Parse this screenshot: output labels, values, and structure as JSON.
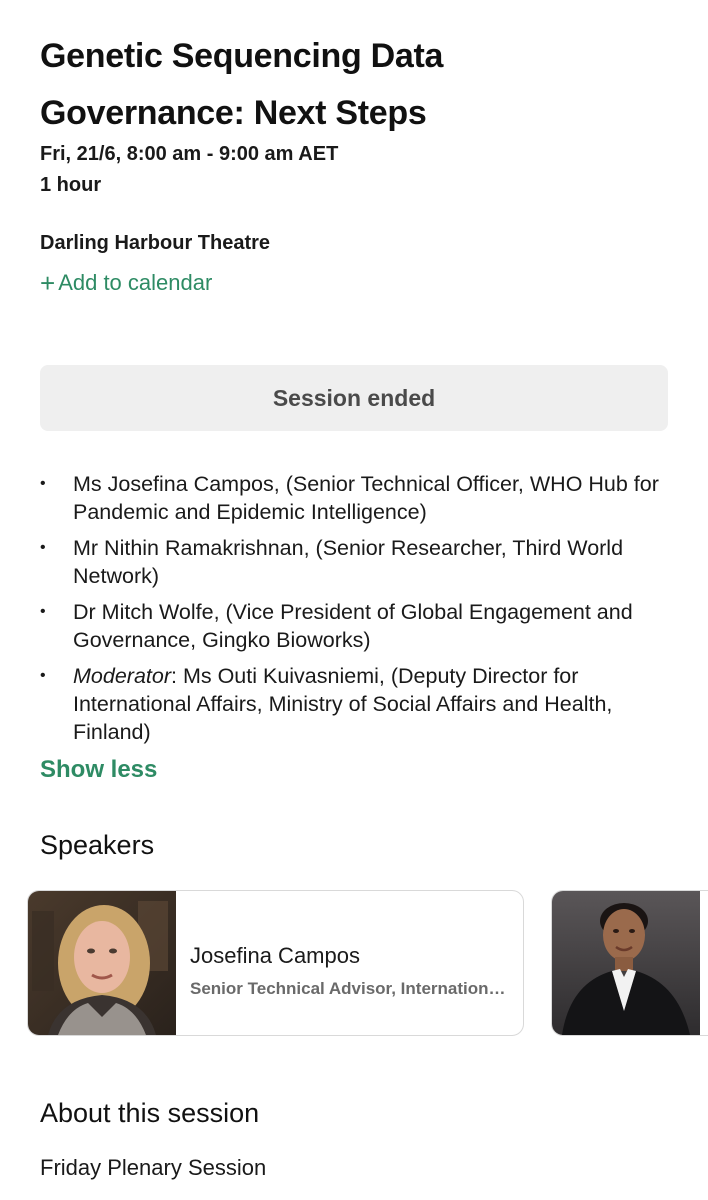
{
  "event": {
    "title_line1": "Genetic Sequencing Data",
    "title_line2": "Governance: Next Steps",
    "datetime": "Fri, 21/6, 8:00 am - 9:00 am AET",
    "duration": "1 hour",
    "location": "Darling Harbour Theatre",
    "add_to_calendar_icon": "plus-icon",
    "add_to_calendar_label": "Add to calendar",
    "status_label": "Session ended"
  },
  "description": {
    "items": [
      {
        "prefix": "",
        "text": "Ms Josefina Campos, (Senior Technical Officer, WHO Hub for Pandemic and Epidemic Intelligence)"
      },
      {
        "prefix": "",
        "text": "Mr Nithin Ramakrishnan, (Senior Researcher, Third World Network)"
      },
      {
        "prefix": "",
        "text": "Dr Mitch Wolfe, (Vice President of Global Engagement and Governance, Gingko Bioworks)"
      },
      {
        "prefix": "Moderator",
        "text": ": Ms Outi Kuivasniemi, (Deputy Director for International Affairs, Ministry of Social Affairs and Health, Finland)"
      }
    ],
    "bullet": "•",
    "show_less_label": "Show less"
  },
  "speakers": {
    "heading": "Speakers",
    "cards": [
      {
        "name": "Josefina Campos",
        "role": "Senior Technical Advisor, International Agency for Research",
        "photo_icon": "speaker-photo"
      },
      {
        "name": "",
        "role": "",
        "photo_icon": "speaker-photo"
      }
    ]
  },
  "about": {
    "heading": "About this session",
    "text": "Friday Plenary Session"
  },
  "colors": {
    "accent": "#2e8b64",
    "button_bg": "#efefef",
    "text": "#111111",
    "muted": "#6a6a6a"
  }
}
